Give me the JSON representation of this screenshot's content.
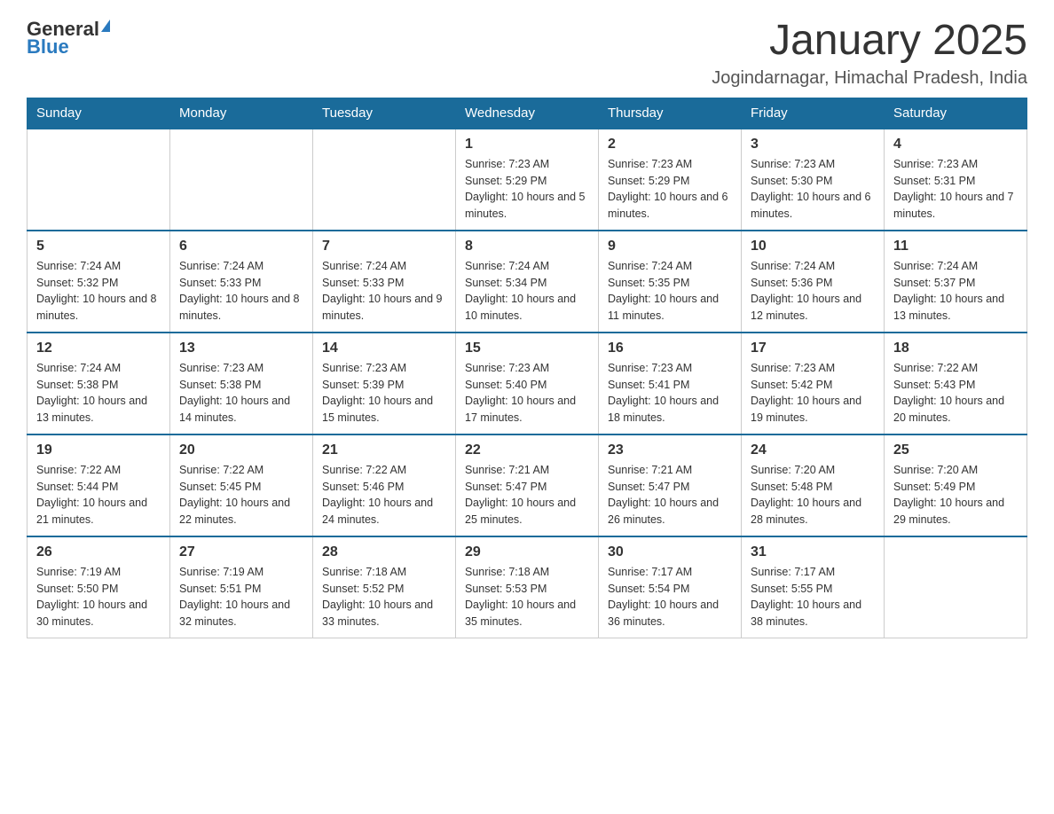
{
  "header": {
    "logo_general": "General",
    "logo_blue": "Blue",
    "month_title": "January 2025",
    "location": "Jogindarnagar, Himachal Pradesh, India"
  },
  "days_of_week": [
    "Sunday",
    "Monday",
    "Tuesday",
    "Wednesday",
    "Thursday",
    "Friday",
    "Saturday"
  ],
  "weeks": [
    [
      {
        "day": "",
        "info": ""
      },
      {
        "day": "",
        "info": ""
      },
      {
        "day": "",
        "info": ""
      },
      {
        "day": "1",
        "info": "Sunrise: 7:23 AM\nSunset: 5:29 PM\nDaylight: 10 hours and 5 minutes."
      },
      {
        "day": "2",
        "info": "Sunrise: 7:23 AM\nSunset: 5:29 PM\nDaylight: 10 hours and 6 minutes."
      },
      {
        "day": "3",
        "info": "Sunrise: 7:23 AM\nSunset: 5:30 PM\nDaylight: 10 hours and 6 minutes."
      },
      {
        "day": "4",
        "info": "Sunrise: 7:23 AM\nSunset: 5:31 PM\nDaylight: 10 hours and 7 minutes."
      }
    ],
    [
      {
        "day": "5",
        "info": "Sunrise: 7:24 AM\nSunset: 5:32 PM\nDaylight: 10 hours and 8 minutes."
      },
      {
        "day": "6",
        "info": "Sunrise: 7:24 AM\nSunset: 5:33 PM\nDaylight: 10 hours and 8 minutes."
      },
      {
        "day": "7",
        "info": "Sunrise: 7:24 AM\nSunset: 5:33 PM\nDaylight: 10 hours and 9 minutes."
      },
      {
        "day": "8",
        "info": "Sunrise: 7:24 AM\nSunset: 5:34 PM\nDaylight: 10 hours and 10 minutes."
      },
      {
        "day": "9",
        "info": "Sunrise: 7:24 AM\nSunset: 5:35 PM\nDaylight: 10 hours and 11 minutes."
      },
      {
        "day": "10",
        "info": "Sunrise: 7:24 AM\nSunset: 5:36 PM\nDaylight: 10 hours and 12 minutes."
      },
      {
        "day": "11",
        "info": "Sunrise: 7:24 AM\nSunset: 5:37 PM\nDaylight: 10 hours and 13 minutes."
      }
    ],
    [
      {
        "day": "12",
        "info": "Sunrise: 7:24 AM\nSunset: 5:38 PM\nDaylight: 10 hours and 13 minutes."
      },
      {
        "day": "13",
        "info": "Sunrise: 7:23 AM\nSunset: 5:38 PM\nDaylight: 10 hours and 14 minutes."
      },
      {
        "day": "14",
        "info": "Sunrise: 7:23 AM\nSunset: 5:39 PM\nDaylight: 10 hours and 15 minutes."
      },
      {
        "day": "15",
        "info": "Sunrise: 7:23 AM\nSunset: 5:40 PM\nDaylight: 10 hours and 17 minutes."
      },
      {
        "day": "16",
        "info": "Sunrise: 7:23 AM\nSunset: 5:41 PM\nDaylight: 10 hours and 18 minutes."
      },
      {
        "day": "17",
        "info": "Sunrise: 7:23 AM\nSunset: 5:42 PM\nDaylight: 10 hours and 19 minutes."
      },
      {
        "day": "18",
        "info": "Sunrise: 7:22 AM\nSunset: 5:43 PM\nDaylight: 10 hours and 20 minutes."
      }
    ],
    [
      {
        "day": "19",
        "info": "Sunrise: 7:22 AM\nSunset: 5:44 PM\nDaylight: 10 hours and 21 minutes."
      },
      {
        "day": "20",
        "info": "Sunrise: 7:22 AM\nSunset: 5:45 PM\nDaylight: 10 hours and 22 minutes."
      },
      {
        "day": "21",
        "info": "Sunrise: 7:22 AM\nSunset: 5:46 PM\nDaylight: 10 hours and 24 minutes."
      },
      {
        "day": "22",
        "info": "Sunrise: 7:21 AM\nSunset: 5:47 PM\nDaylight: 10 hours and 25 minutes."
      },
      {
        "day": "23",
        "info": "Sunrise: 7:21 AM\nSunset: 5:47 PM\nDaylight: 10 hours and 26 minutes."
      },
      {
        "day": "24",
        "info": "Sunrise: 7:20 AM\nSunset: 5:48 PM\nDaylight: 10 hours and 28 minutes."
      },
      {
        "day": "25",
        "info": "Sunrise: 7:20 AM\nSunset: 5:49 PM\nDaylight: 10 hours and 29 minutes."
      }
    ],
    [
      {
        "day": "26",
        "info": "Sunrise: 7:19 AM\nSunset: 5:50 PM\nDaylight: 10 hours and 30 minutes."
      },
      {
        "day": "27",
        "info": "Sunrise: 7:19 AM\nSunset: 5:51 PM\nDaylight: 10 hours and 32 minutes."
      },
      {
        "day": "28",
        "info": "Sunrise: 7:18 AM\nSunset: 5:52 PM\nDaylight: 10 hours and 33 minutes."
      },
      {
        "day": "29",
        "info": "Sunrise: 7:18 AM\nSunset: 5:53 PM\nDaylight: 10 hours and 35 minutes."
      },
      {
        "day": "30",
        "info": "Sunrise: 7:17 AM\nSunset: 5:54 PM\nDaylight: 10 hours and 36 minutes."
      },
      {
        "day": "31",
        "info": "Sunrise: 7:17 AM\nSunset: 5:55 PM\nDaylight: 10 hours and 38 minutes."
      },
      {
        "day": "",
        "info": ""
      }
    ]
  ]
}
